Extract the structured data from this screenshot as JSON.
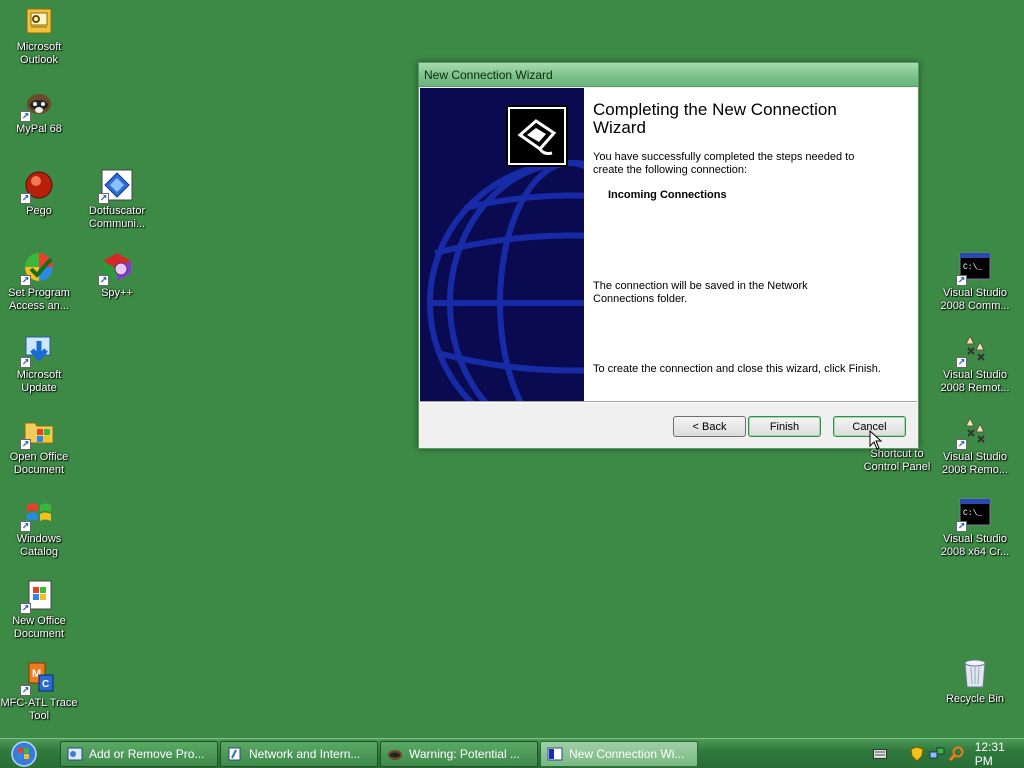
{
  "desktop": {
    "left_icons": [
      {
        "label": "Microsoft Outlook",
        "icon": "outlook-icon"
      },
      {
        "label": "MyPal 68",
        "icon": "mypal-icon"
      },
      {
        "label": "Pego",
        "icon": "pego-icon"
      },
      {
        "label": "Dotfuscator Communi...",
        "icon": "dotfuscator-icon"
      },
      {
        "label": "Set Program Access an...",
        "icon": "program-access-icon"
      },
      {
        "label": "Spy++",
        "icon": "spy-icon"
      },
      {
        "label": "Microsoft Update",
        "icon": "microsoft-update-icon"
      },
      {
        "label": "Open Office Document",
        "icon": "open-office-icon"
      },
      {
        "label": "Windows Catalog",
        "icon": "windows-catalog-icon"
      },
      {
        "label": "New Office Document",
        "icon": "new-office-icon"
      },
      {
        "label": "MFC-ATL Trace Tool",
        "icon": "trace-tool-icon"
      }
    ],
    "right_icons": [
      {
        "label": "Visual Studio 2008 Comm...",
        "icon": "cmd-icon"
      },
      {
        "label": "Visual Studio 2008 Remot...",
        "icon": "remote-debug-icon"
      },
      {
        "label": "Shortcut to Control Panel",
        "icon": "control-panel-icon"
      },
      {
        "label": "Visual Studio 2008 Remo...",
        "icon": "remote-debug-icon"
      },
      {
        "label": "Visual Studio 2008 x64 Cr...",
        "icon": "cmd-icon"
      },
      {
        "label": "Recycle Bin",
        "icon": "recycle-bin-icon"
      }
    ]
  },
  "wizard": {
    "title": "New Connection Wizard",
    "heading": "Completing the New Connection Wizard",
    "intro": "You have successfully completed the steps needed to create the following connection:",
    "connection_name": "Incoming Connections",
    "save_note": "The connection will be saved in the Network Connections folder.",
    "finish_hint": "To create the connection and close this wizard, click Finish.",
    "buttons": {
      "back": "< Back",
      "finish": "Finish",
      "cancel": "Cancel"
    }
  },
  "taskbar": {
    "items": [
      {
        "label": "Add or Remove Pro...",
        "icon": "add-remove-icon",
        "active": false
      },
      {
        "label": "Network and Intern...",
        "icon": "network-icon",
        "active": false
      },
      {
        "label": "Warning: Potential ...",
        "icon": "warning-icon",
        "active": false
      },
      {
        "label": "New Connection Wi...",
        "icon": "wizard-icon",
        "active": true
      }
    ],
    "clock": "12:31 PM"
  }
}
